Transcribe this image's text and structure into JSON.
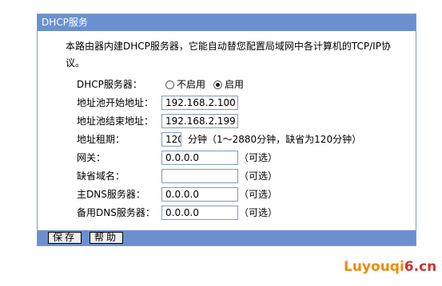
{
  "panel": {
    "title": "DHCP服务",
    "description": "本路由器内建DHCP服务器，它能自动替您配置局域网中各计算机的TCP/IP协议。"
  },
  "dhcp_server": {
    "label": "DHCP服务器：",
    "options": [
      "不启用",
      "启用"
    ],
    "selected": "启用"
  },
  "pool_start": {
    "label": "地址池开始地址：",
    "value": "192.168.2.100"
  },
  "pool_end": {
    "label": "地址池结束地址：",
    "value": "192.168.2.199"
  },
  "lease": {
    "label": "地址租期：",
    "value": "120",
    "note": "分钟（1～2880分钟，缺省为120分钟）"
  },
  "gateway": {
    "label": "网关：",
    "value": "0.0.0.0",
    "note": "（可选）"
  },
  "domain": {
    "label": "缺省域名：",
    "value": "",
    "note": "（可选）"
  },
  "primary_dns": {
    "label": "主DNS服务器：",
    "value": "0.0.0.0",
    "note": "（可选）"
  },
  "backup_dns": {
    "label": "备用DNS服务器：",
    "value": "0.0.0.0",
    "note": "（可选）"
  },
  "buttons": {
    "save": "保存",
    "help": "帮助"
  },
  "watermark": {
    "part1": "Luyouqi",
    "part2": "6.cn"
  },
  "colors": {
    "title_bar": "#6b90d0",
    "input_border": "#7f9db9",
    "watermark_orange": "#f08a00",
    "watermark_red": "#d42e2e"
  }
}
